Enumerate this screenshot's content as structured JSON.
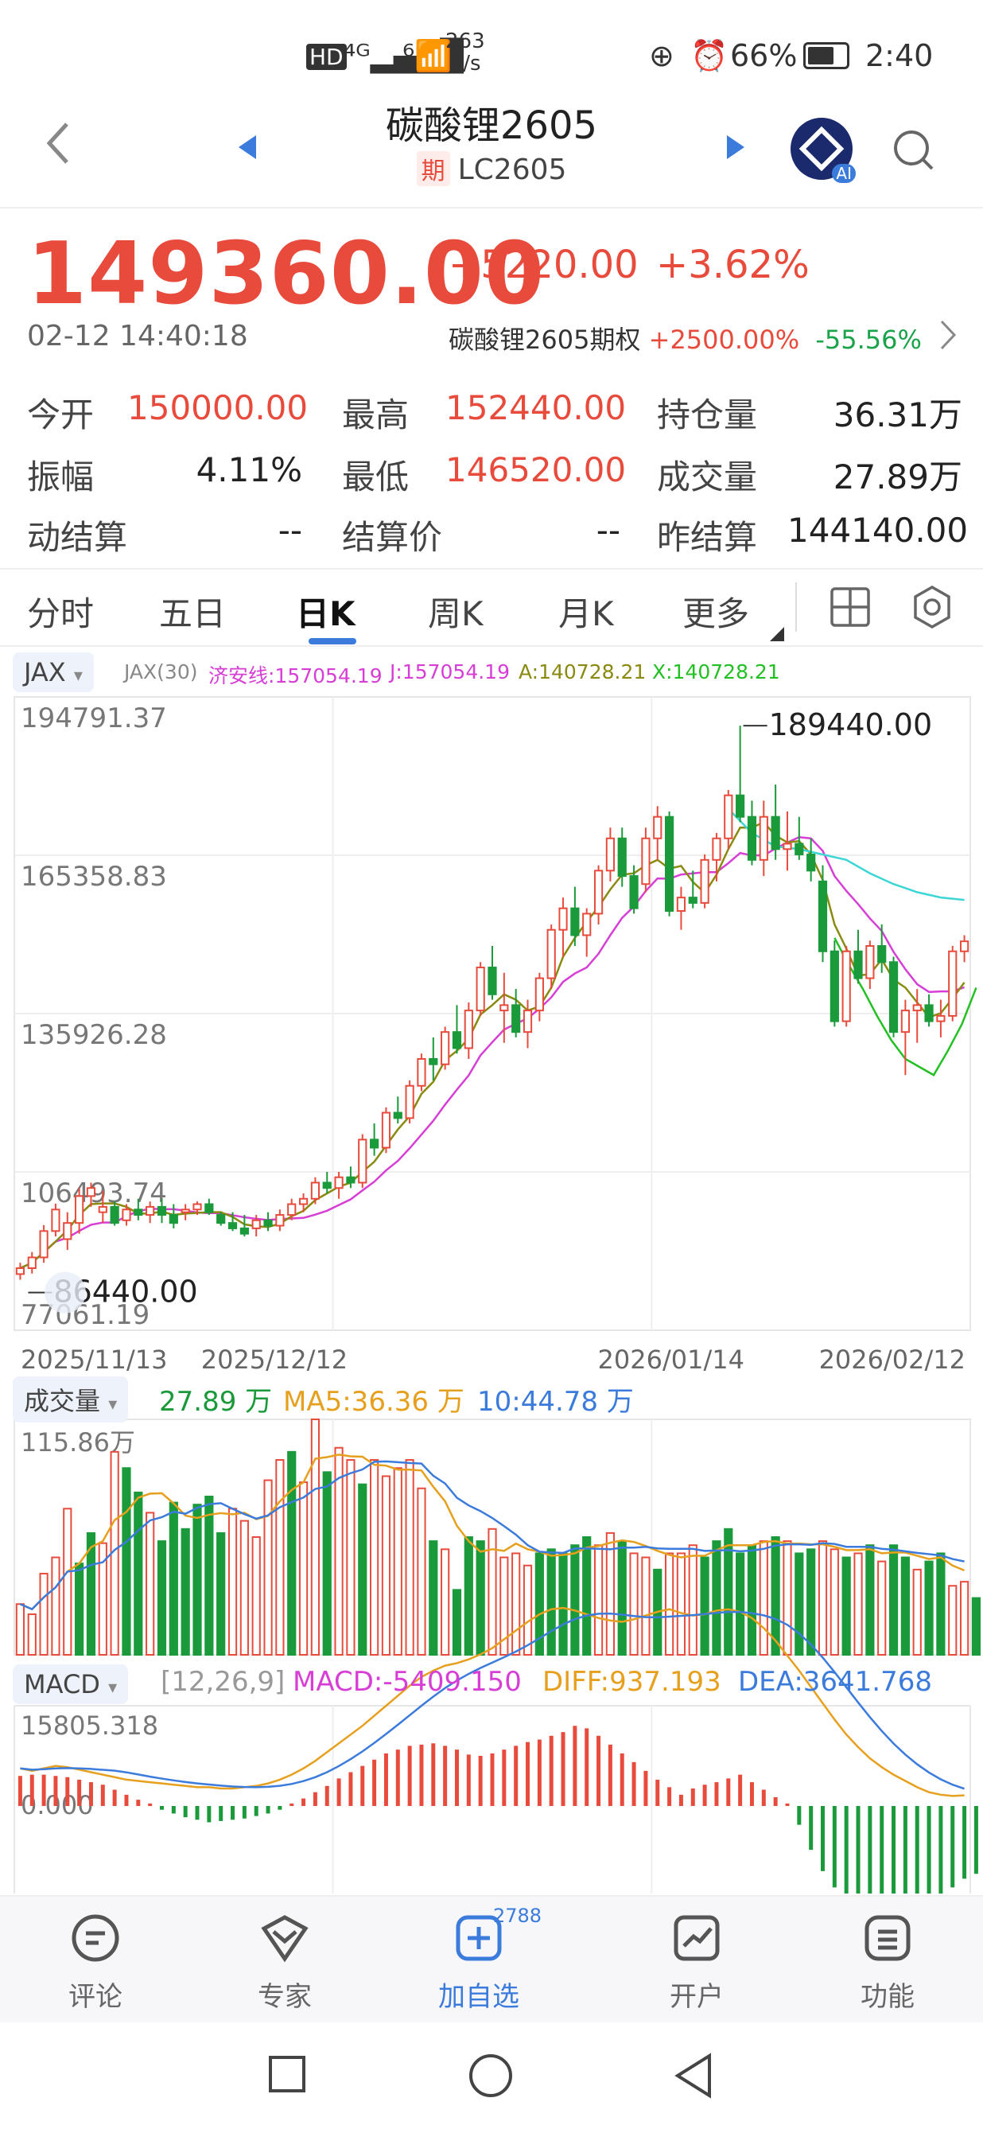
{
  "status_bar": {
    "left_icons": [
      "hd-icon",
      "4g-signal-icon",
      "wifi-icon"
    ],
    "net_speed": "263",
    "net_unit": "K/s",
    "battery": "66%",
    "time": "2:40"
  },
  "nav": {
    "title": "碳酸锂2605",
    "badge": "期",
    "code": "LC2605",
    "ai_label": "AI"
  },
  "quote": {
    "price": "149360.00",
    "change": "+5220.00",
    "change_pct": "+3.62%",
    "datetime": "02-12 14:40:18",
    "option_label": "碳酸锂2605期权",
    "option_change": "+2500.00%",
    "option_pct": "-55.56%"
  },
  "stats": [
    {
      "label": "今开",
      "value": "150000.00",
      "color": "#e84b3c"
    },
    {
      "label": "最高",
      "value": "152440.00",
      "color": "#e84b3c"
    },
    {
      "label": "持仓量",
      "value": "36.31万",
      "color": "#222222"
    },
    {
      "label": "振幅",
      "value": "4.11%",
      "color": "#222222"
    },
    {
      "label": "最低",
      "value": "146520.00",
      "color": "#e84b3c"
    },
    {
      "label": "成交量",
      "value": "27.89万",
      "color": "#222222"
    },
    {
      "label": "动结算",
      "value": "--",
      "color": "#222222"
    },
    {
      "label": "结算价",
      "value": "--",
      "color": "#222222"
    },
    {
      "label": "昨结算",
      "value": "144140.00",
      "color": "#222222"
    }
  ],
  "tabs": [
    "分时",
    "五日",
    "日K",
    "周K",
    "月K",
    "更多"
  ],
  "active_tab": "日K",
  "kline_legend": {
    "selector": "JAX",
    "name": "JAX(30)",
    "jax_line": "济安线:157054.19",
    "j": "J:157054.19",
    "a": "A:140728.21",
    "x": "X:140728.21"
  },
  "volume_legend": {
    "selector": "成交量",
    "vol": "27.89 万",
    "ma5": "MA5:36.36 万",
    "ma10": "10:44.78 万",
    "ymax": "115.86万"
  },
  "macd_legend": {
    "selector": "MACD",
    "params": "[12,26,9]",
    "macd": "MACD:-5409.150",
    "diff": "DIFF:937.193",
    "dea": "DEA:3641.768",
    "ymax": "15805.318",
    "zero": "0.000"
  },
  "colors": {
    "up": "#e84b3c",
    "down": "#1a9a3a",
    "accent": "#3b7bdc",
    "jax": "#d63ed6",
    "cyan": "#3dd6d6",
    "olive": "#8a8a10",
    "x_line": "#22c022"
  },
  "chart_data": {
    "type": "candlestick",
    "y_ticks": [
      "194791.37",
      "165358.83",
      "135926.28",
      "106493.74",
      "77061.19"
    ],
    "ylim": [
      77061.19,
      194791.37
    ],
    "x_ticks": [
      "2025/11/13",
      "2025/12/12",
      "2026/01/14",
      "2026/02/12"
    ],
    "max_label": "189440.00",
    "min_label": "86440.00",
    "candles": [
      [
        87500,
        89600,
        86440,
        88600
      ],
      [
        88600,
        91600,
        87600,
        90600
      ],
      [
        90600,
        96600,
        89600,
        95500
      ],
      [
        95500,
        100600,
        94500,
        99500
      ],
      [
        94000,
        99000,
        92000,
        97000
      ],
      [
        97000,
        103500,
        95000,
        102000
      ],
      [
        102000,
        104500,
        100000,
        103500
      ],
      [
        99000,
        103000,
        97000,
        100000
      ],
      [
        100000,
        101000,
        96500,
        97000
      ],
      [
        97500,
        100500,
        96500,
        99500
      ],
      [
        99500,
        101500,
        97500,
        98500
      ],
      [
        98500,
        101000,
        97000,
        100000
      ],
      [
        100000,
        101500,
        97000,
        98500
      ],
      [
        98500,
        100500,
        96000,
        97000
      ],
      [
        99000,
        100500,
        97500,
        99500
      ],
      [
        99500,
        101000,
        98500,
        100500
      ],
      [
        100500,
        101500,
        98500,
        99000
      ],
      [
        98500,
        99000,
        96500,
        97000
      ],
      [
        97000,
        99000,
        95500,
        96000
      ],
      [
        96000,
        98500,
        94500,
        95000
      ],
      [
        96000,
        98500,
        94500,
        97500
      ],
      [
        97500,
        99000,
        95500,
        96500
      ],
      [
        96500,
        99500,
        95500,
        98500
      ],
      [
        98500,
        101500,
        97500,
        100500
      ],
      [
        100500,
        102500,
        99000,
        101500
      ],
      [
        101500,
        105500,
        100500,
        104500
      ],
      [
        104500,
        106500,
        102500,
        103500
      ],
      [
        103500,
        106500,
        101500,
        105500
      ],
      [
        105500,
        107500,
        103500,
        104500
      ],
      [
        104500,
        113500,
        103500,
        112500
      ],
      [
        112500,
        115500,
        109500,
        111000
      ],
      [
        111000,
        118500,
        110000,
        117500
      ],
      [
        117500,
        120500,
        115500,
        116500
      ],
      [
        116500,
        123500,
        115500,
        122500
      ],
      [
        122500,
        128500,
        121500,
        127500
      ],
      [
        127500,
        131500,
        123500,
        126500
      ],
      [
        126500,
        133500,
        125500,
        132500
      ],
      [
        132500,
        137500,
        128500,
        129500
      ],
      [
        129500,
        138000,
        127500,
        136500
      ],
      [
        136500,
        145500,
        135500,
        144500
      ],
      [
        144500,
        148500,
        138500,
        139500
      ],
      [
        136500,
        143500,
        130500,
        137500
      ],
      [
        137500,
        140500,
        131500,
        132500
      ],
      [
        132500,
        138500,
        129500,
        136500
      ],
      [
        136500,
        143500,
        134500,
        142500
      ],
      [
        142500,
        152500,
        140500,
        151500
      ],
      [
        151500,
        157500,
        146500,
        155500
      ],
      [
        155500,
        159500,
        148500,
        150500
      ],
      [
        150500,
        155500,
        146500,
        154500
      ],
      [
        154500,
        163500,
        152500,
        162500
      ],
      [
        162500,
        170500,
        160500,
        168500
      ],
      [
        168500,
        170500,
        159500,
        161500
      ],
      [
        161500,
        163500,
        154500,
        155500
      ],
      [
        160000,
        170500,
        158500,
        168500
      ],
      [
        168500,
        174500,
        164500,
        172500
      ],
      [
        172500,
        173500,
        154000,
        155000
      ],
      [
        155000,
        159500,
        151500,
        157500
      ],
      [
        157500,
        162500,
        155500,
        156500
      ],
      [
        156500,
        165500,
        155500,
        164500
      ],
      [
        164500,
        169500,
        160500,
        168500
      ],
      [
        168500,
        177500,
        166500,
        176500
      ],
      [
        176500,
        189440,
        171500,
        172500
      ],
      [
        172500,
        175500,
        163500,
        164500
      ],
      [
        164500,
        175500,
        161500,
        172500
      ],
      [
        172500,
        178500,
        164500,
        166500
      ],
      [
        166500,
        173500,
        162500,
        167500
      ],
      [
        167500,
        172500,
        164500,
        165500
      ],
      [
        165500,
        168500,
        160500,
        162500
      ],
      [
        160500,
        163500,
        145500,
        147500
      ],
      [
        147500,
        149500,
        133500,
        134500
      ],
      [
        134500,
        148500,
        133500,
        147500
      ],
      [
        147500,
        151500,
        141500,
        142500
      ],
      [
        142500,
        149500,
        140500,
        148500
      ],
      [
        148500,
        152500,
        143500,
        145500
      ],
      [
        145500,
        146500,
        131500,
        132500
      ],
      [
        132500,
        138500,
        124500,
        136500
      ],
      [
        136500,
        140500,
        130500,
        137500
      ],
      [
        137500,
        139500,
        133500,
        134500
      ],
      [
        134500,
        138500,
        131500,
        135500
      ],
      [
        135500,
        148500,
        134500,
        147500
      ],
      [
        147500,
        150500,
        145500,
        149360
      ]
    ],
    "volume": [
      [
        25,
        1
      ],
      [
        20,
        1
      ],
      [
        40,
        1
      ],
      [
        48,
        1
      ],
      [
        72,
        1
      ],
      [
        45,
        0
      ],
      [
        60,
        0
      ],
      [
        55,
        1
      ],
      [
        100,
        1
      ],
      [
        92,
        0
      ],
      [
        80,
        0
      ],
      [
        70,
        1
      ],
      [
        56,
        0
      ],
      [
        75,
        0
      ],
      [
        62,
        0
      ],
      [
        74,
        0
      ],
      [
        78,
        0
      ],
      [
        60,
        0
      ],
      [
        72,
        1
      ],
      [
        66,
        1
      ],
      [
        58,
        1
      ],
      [
        86,
        1
      ],
      [
        96,
        1
      ],
      [
        100,
        0
      ],
      [
        85,
        1
      ],
      [
        116,
        1
      ],
      [
        90,
        0
      ],
      [
        102,
        1
      ],
      [
        96,
        1
      ],
      [
        84,
        0
      ],
      [
        96,
        1
      ],
      [
        88,
        1
      ],
      [
        92,
        1
      ],
      [
        96,
        1
      ],
      [
        82,
        1
      ],
      [
        56,
        0
      ],
      [
        52,
        1
      ],
      [
        32,
        0
      ],
      [
        58,
        0
      ],
      [
        56,
        0
      ],
      [
        62,
        1
      ],
      [
        48,
        1
      ],
      [
        50,
        1
      ],
      [
        44,
        1
      ],
      [
        50,
        0
      ],
      [
        52,
        0
      ],
      [
        50,
        0
      ],
      [
        54,
        0
      ],
      [
        58,
        0
      ],
      [
        54,
        1
      ],
      [
        60,
        1
      ],
      [
        56,
        0
      ],
      [
        50,
        1
      ],
      [
        48,
        1
      ],
      [
        42,
        0
      ],
      [
        50,
        1
      ],
      [
        50,
        1
      ],
      [
        54,
        1
      ],
      [
        48,
        0
      ],
      [
        56,
        0
      ],
      [
        62,
        0
      ],
      [
        50,
        0
      ],
      [
        54,
        0
      ],
      [
        56,
        1
      ],
      [
        58,
        0
      ],
      [
        56,
        1
      ],
      [
        50,
        0
      ],
      [
        52,
        0
      ],
      [
        56,
        1
      ],
      [
        52,
        1
      ],
      [
        48,
        0
      ],
      [
        50,
        1
      ],
      [
        54,
        0
      ],
      [
        46,
        1
      ],
      [
        54,
        0
      ],
      [
        48,
        0
      ],
      [
        42,
        1
      ],
      [
        46,
        0
      ],
      [
        50,
        0
      ],
      [
        34,
        1
      ],
      [
        36,
        1
      ],
      [
        28,
        0
      ]
    ],
    "macd_hist": [
      2400,
      2500,
      2500,
      2400,
      2300,
      2100,
      1900,
      1700,
      1300,
      900,
      500,
      200,
      -300,
      -600,
      -900,
      -1100,
      -1300,
      -1200,
      -1100,
      -1000,
      -800,
      -600,
      -300,
      200,
      600,
      1100,
      1600,
      2200,
      2700,
      3200,
      3700,
      4200,
      4500,
      4800,
      4900,
      5000,
      4800,
      4500,
      4100,
      4000,
      4200,
      4500,
      4800,
      5100,
      5300,
      5600,
      5900,
      6400,
      6200,
      5600,
      4900,
      4200,
      3500,
      2800,
      2100,
      1500,
      900,
      1400,
      1700,
      1900,
      2200,
      2500,
      1900,
      1300,
      700,
      200,
      -1500,
      -3500,
      -5200,
      -6500,
      -7500,
      -8000,
      -8200,
      -8300,
      -8400,
      -8400,
      -8200,
      -7800,
      -7200,
      -6500,
      -5800,
      -5409
    ]
  }
}
